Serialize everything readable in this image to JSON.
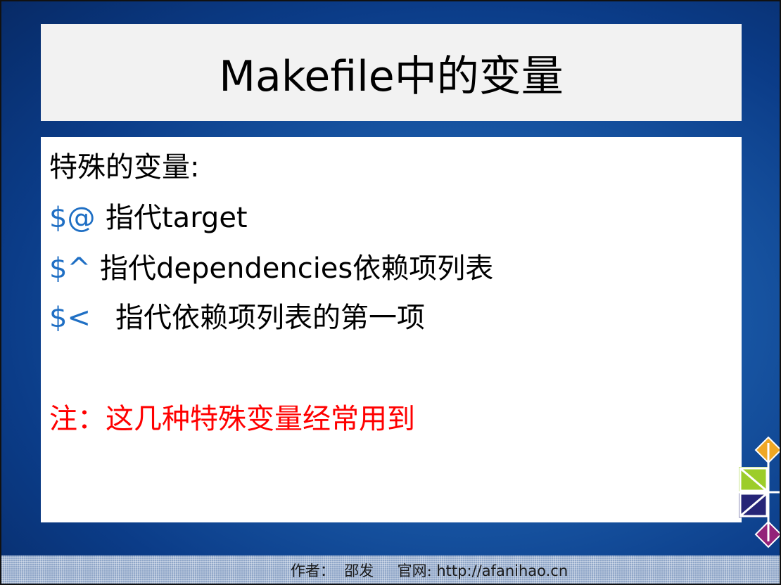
{
  "slide": {
    "title": "Makefile中的变量",
    "lines": [
      {
        "text": "特殊的变量:"
      },
      {
        "symbol": "$@",
        "text": "指代target"
      },
      {
        "symbol": "$^",
        "text": "指代dependencies依赖项列表"
      },
      {
        "symbol": "$<",
        "text": "指代依赖项列表的第一项"
      }
    ],
    "note": "注：这几种特殊变量经常用到"
  },
  "footer": {
    "author_label": "作者：",
    "author": "邵发",
    "site_label": "官网:",
    "url": "http://afanihao.cn"
  },
  "colors": {
    "symbol": "#1f6fc4",
    "note": "#ff0000",
    "background": "#1a5aa8"
  },
  "icons": {
    "logo": "centos-logo-icon"
  }
}
